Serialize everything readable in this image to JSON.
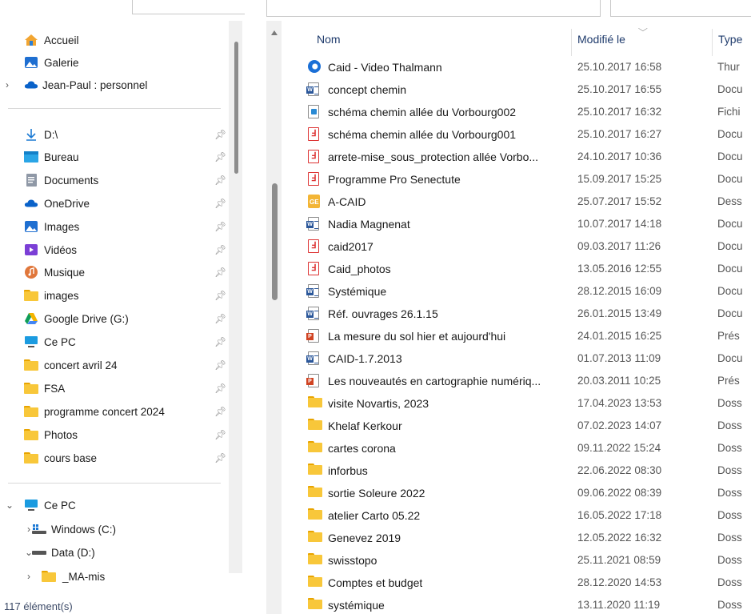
{
  "navigation": {
    "pinned_top": [
      {
        "label": "Accueil",
        "icon": "home-icon"
      },
      {
        "label": "Galerie",
        "icon": "gallery-icon"
      },
      {
        "label": "Jean-Paul : personnel",
        "icon": "onedrive-cloud-icon",
        "expandable": true
      }
    ],
    "quick_access": [
      {
        "label": "D:\\",
        "icon": "download-arrow-icon"
      },
      {
        "label": "Bureau",
        "icon": "desktop-icon"
      },
      {
        "label": "Documents",
        "icon": "documents-icon"
      },
      {
        "label": "OneDrive",
        "icon": "onedrive-cloud-icon"
      },
      {
        "label": "Images",
        "icon": "pictures-icon"
      },
      {
        "label": "Vidéos",
        "icon": "videos-icon"
      },
      {
        "label": "Musique",
        "icon": "music-icon"
      },
      {
        "label": "images",
        "icon": "folder-icon"
      },
      {
        "label": "Google Drive (G:)",
        "icon": "google-drive-icon"
      },
      {
        "label": "Ce PC",
        "icon": "computer-icon"
      },
      {
        "label": "concert avril 24",
        "icon": "folder-icon"
      },
      {
        "label": "FSA",
        "icon": "folder-icon"
      },
      {
        "label": "programme concert 2024",
        "icon": "folder-icon"
      },
      {
        "label": "Photos",
        "icon": "folder-icon"
      },
      {
        "label": "cours base",
        "icon": "folder-icon"
      }
    ],
    "this_pc": {
      "label": "Ce PC",
      "icon": "computer-icon"
    },
    "drives": [
      {
        "label": "Windows (C:)",
        "icon": "windows-drive-icon"
      },
      {
        "label": "Data (D:)",
        "icon": "drive-icon"
      }
    ],
    "subfolders": [
      {
        "label": "_MA-mis",
        "icon": "folder-icon"
      }
    ]
  },
  "status": {
    "item_count": "117 élément(s)"
  },
  "columns": {
    "name": "Nom",
    "modified": "Modifié le",
    "type": "Type"
  },
  "files": [
    {
      "name": "Caid - Video Thalmann",
      "date": "25.10.2017 16:58",
      "type": "Thur",
      "icon": "thunderbird-icon"
    },
    {
      "name": "concept chemin",
      "date": "25.10.2017 16:55",
      "type": "Docu",
      "icon": "word-doc-icon"
    },
    {
      "name": "schéma chemin allée du Vorbourg002",
      "date": "25.10.2017 16:32",
      "type": "Fichi",
      "icon": "image-file-icon"
    },
    {
      "name": "schéma chemin allée du Vorbourg001",
      "date": "25.10.2017 16:27",
      "type": "Docu",
      "icon": "pdf-icon"
    },
    {
      "name": "arrete-mise_sous_protection allée Vorbo...",
      "date": "24.10.2017 10:36",
      "type": "Docu",
      "icon": "pdf-icon"
    },
    {
      "name": "Programme Pro Senectute",
      "date": "15.09.2017 15:25",
      "type": "Docu",
      "icon": "pdf-icon"
    },
    {
      "name": "A-CAID",
      "date": "25.07.2017 15:52",
      "type": "Dess",
      "icon": "drawing-file-icon"
    },
    {
      "name": "Nadia Magnenat",
      "date": "10.07.2017 14:18",
      "type": "Docu",
      "icon": "word-doc-icon"
    },
    {
      "name": "caid2017",
      "date": "09.03.2017 11:26",
      "type": "Docu",
      "icon": "pdf-icon"
    },
    {
      "name": "Caid_photos",
      "date": "13.05.2016 12:55",
      "type": "Docu",
      "icon": "pdf-icon"
    },
    {
      "name": "Systémique",
      "date": "28.12.2015 16:09",
      "type": "Docu",
      "icon": "word-doc-icon"
    },
    {
      "name": "Réf. ouvrages 26.1.15",
      "date": "26.01.2015 13:49",
      "type": "Docu",
      "icon": "word-doc-icon"
    },
    {
      "name": "La mesure du sol hier et aujourd'hui",
      "date": "24.01.2015 16:25",
      "type": "Prés",
      "icon": "powerpoint-icon"
    },
    {
      "name": "CAID-1.7.2013",
      "date": "01.07.2013 11:09",
      "type": "Docu",
      "icon": "word-doc-icon"
    },
    {
      "name": "Les nouveautés en cartographie numériq...",
      "date": "20.03.2011 10:25",
      "type": "Prés",
      "icon": "powerpoint-icon"
    },
    {
      "name": "visite Novartis, 2023",
      "date": "17.04.2023 13:53",
      "type": "Doss",
      "icon": "folder-icon"
    },
    {
      "name": "Khelaf Kerkour",
      "date": "07.02.2023 14:07",
      "type": "Doss",
      "icon": "folder-icon"
    },
    {
      "name": "cartes corona",
      "date": "09.11.2022 15:24",
      "type": "Doss",
      "icon": "folder-icon"
    },
    {
      "name": "inforbus",
      "date": "22.06.2022 08:30",
      "type": "Doss",
      "icon": "folder-icon"
    },
    {
      "name": "sortie Soleure 2022",
      "date": "09.06.2022 08:39",
      "type": "Doss",
      "icon": "folder-icon"
    },
    {
      "name": "atelier Carto 05.22",
      "date": "16.05.2022 17:18",
      "type": "Doss",
      "icon": "folder-icon"
    },
    {
      "name": "Genevez 2019",
      "date": "12.05.2022 16:32",
      "type": "Doss",
      "icon": "folder-icon"
    },
    {
      "name": "swisstopo",
      "date": "25.11.2021 08:59",
      "type": "Doss",
      "icon": "folder-icon"
    },
    {
      "name": "Comptes et budget",
      "date": "28.12.2020 14:53",
      "type": "Doss",
      "icon": "folder-icon"
    },
    {
      "name": "systémique",
      "date": "13.11.2020 11:19",
      "type": "Doss",
      "icon": "folder-icon"
    }
  ],
  "colors": {
    "folder": "#f8c73a",
    "word": "#2b579a",
    "pdf": "#d33333",
    "powerpoint": "#d04423",
    "accent": "#1f3b6c"
  }
}
